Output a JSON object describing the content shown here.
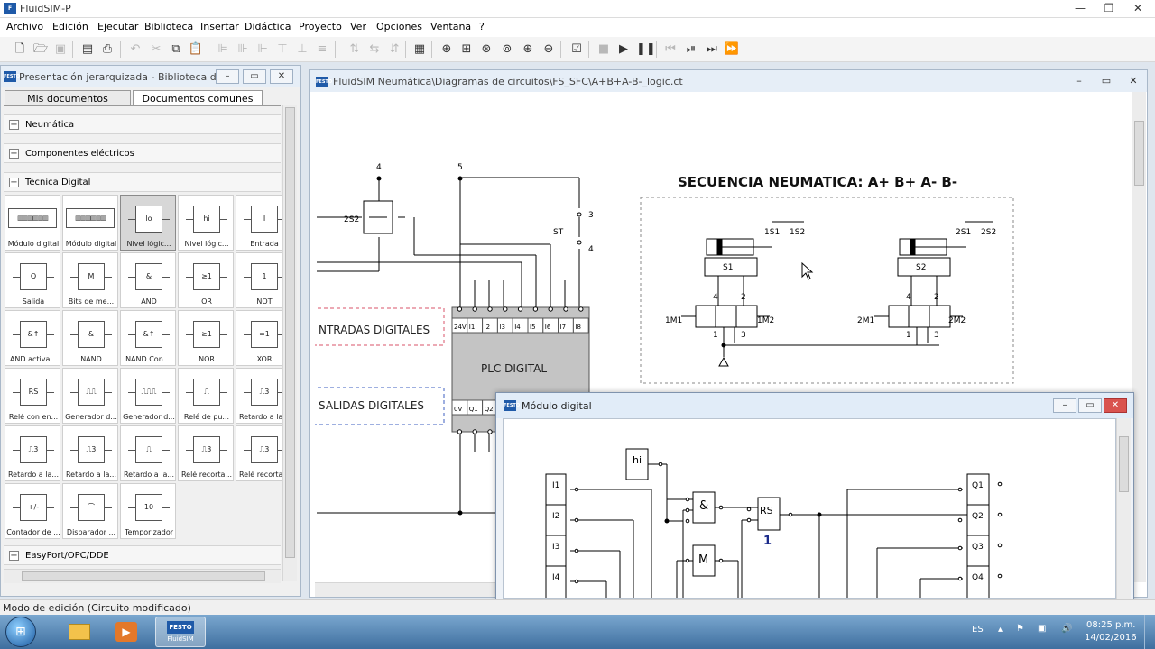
{
  "app": {
    "title": "FluidSIM-P",
    "logo_text": "FESTO"
  },
  "menu": [
    "Archivo",
    "Edición",
    "Ejecutar",
    "Biblioteca",
    "Insertar",
    "Didáctica",
    "Proyecto",
    "Ver",
    "Opciones",
    "Ventana",
    "?"
  ],
  "toolbar": {
    "icons": [
      "new-icon",
      "open-icon",
      "save-icon",
      "print-preview-icon",
      "print-icon",
      "undo-icon",
      "cut-icon",
      "copy-icon",
      "paste-icon",
      "align-left-icon",
      "align-center-icon",
      "align-right-icon",
      "align-top-icon",
      "align-middle-icon",
      "align-bottom-icon",
      "rotate-icon",
      "mirror-icon",
      "flip-icon",
      "grid-icon",
      "zoom-1-icon",
      "zoom-box-icon",
      "zoom-fit-icon",
      "zoom-window-icon",
      "zoom-in-icon",
      "zoom-out-icon",
      "check-icon",
      "stop-icon",
      "play-icon",
      "pause-icon",
      "rewind-icon",
      "step-icon",
      "step-forward-icon",
      "fast-forward-icon"
    ]
  },
  "library": {
    "title": "Presentación jerarquizada - Biblioteca de ...",
    "tabs": [
      "Mis documentos",
      "Documentos comunes"
    ],
    "sections": {
      "neumatica": "Neumática",
      "electricos": "Componentes eléctricos",
      "digital": "Técnica Digital",
      "easyport": "EasyPort/OPC/DDE"
    },
    "items": [
      {
        "label": "Módulo digital",
        "sym": "▥▥▥▥▥▥"
      },
      {
        "label": "Módulo digital",
        "sym": "▥▥▥▥▥▥"
      },
      {
        "label": "Nivel lógic...",
        "sym": "lo"
      },
      {
        "label": "Nivel lógic...",
        "sym": "hi"
      },
      {
        "label": "Entrada",
        "sym": "I"
      },
      {
        "label": "Salida",
        "sym": "Q"
      },
      {
        "label": "Bits de me...",
        "sym": "M"
      },
      {
        "label": "AND",
        "sym": "&"
      },
      {
        "label": "OR",
        "sym": "≥1"
      },
      {
        "label": "NOT",
        "sym": "1"
      },
      {
        "label": "AND activa...",
        "sym": "&↑"
      },
      {
        "label": "NAND",
        "sym": "&"
      },
      {
        "label": "NAND Con ...",
        "sym": "&↑"
      },
      {
        "label": "NOR",
        "sym": "≥1"
      },
      {
        "label": "XOR",
        "sym": "=1"
      },
      {
        "label": "Relé con en...",
        "sym": "RS"
      },
      {
        "label": "Generador d...",
        "sym": "⎍⎍"
      },
      {
        "label": "Generador d...",
        "sym": "⎍⎍⎍"
      },
      {
        "label": "Relé de pu...",
        "sym": "⎍"
      },
      {
        "label": "Retardo a la...",
        "sym": "⎍3"
      },
      {
        "label": "Retardo a la...",
        "sym": "⎍3"
      },
      {
        "label": "Retardo a la...",
        "sym": "⎍3"
      },
      {
        "label": "Retardo a la...",
        "sym": "⎍"
      },
      {
        "label": "Relé recorta...",
        "sym": "⎍3"
      },
      {
        "label": "Relé recorta...",
        "sym": "⎍3"
      },
      {
        "label": "Contador de ...",
        "sym": "+/-"
      },
      {
        "label": "Disparador ...",
        "sym": "⌒"
      },
      {
        "label": "Temporizador",
        "sym": "10"
      }
    ]
  },
  "circuit": {
    "title": "FluidSIM Neumática\\Diagramas de circuitos\\FS_SFC\\A+B+A-B-_logic.ct",
    "heading": "SECUENCIA NEUMATICA: A+ B+ A- B-",
    "labels": {
      "n4": "4",
      "n5": "5",
      "n3": "3",
      "n4b": "4",
      "s2s2": "2S2",
      "st": "ST",
      "entradas": "NTRADAS  DIGITALES",
      "salidas": "SALIDAS  DIGITALES",
      "plc": "PLC  DIGITAL",
      "pins_top": [
        "24V",
        "I1",
        "I2",
        "I3",
        "I4",
        "I5",
        "I6",
        "I7",
        "I8"
      ],
      "pins_bottom": [
        "0V",
        "Q1",
        "Q2"
      ],
      "c1": {
        "s1": "1S1",
        "s2": "1S2",
        "sensor": "S1",
        "m1": "1M1",
        "m2": "1M2",
        "p4": "4",
        "p2": "2",
        "p1": "1",
        "p3": "3"
      },
      "c2": {
        "s1": "2S1",
        "s2": "2S2",
        "sensor": "S2",
        "m1": "2M1",
        "m2": "2M2",
        "p4": "4",
        "p2": "2",
        "p1": "1",
        "p3": "3"
      }
    }
  },
  "module": {
    "title": "Módulo digital",
    "inputs": [
      "I1",
      "I2",
      "I3",
      "I4"
    ],
    "outputs": [
      "Q1",
      "Q2",
      "Q3",
      "Q4"
    ],
    "hi": "hi",
    "and": "&",
    "m": "M",
    "rs": "RS",
    "rs_num": "1"
  },
  "status": {
    "text": "Modo de edición (Circuito modificado)"
  },
  "taskbar": {
    "lang": "ES",
    "time": "08:25 p.m.",
    "date": "14/02/2016",
    "fluidsim_label": "FluidSIM"
  },
  "colors": {
    "accent": "#1f5aa8",
    "dashed_red": "#d9536a",
    "dashed_blue": "#3e5fc0",
    "rs_num": "#1a2a8a"
  }
}
